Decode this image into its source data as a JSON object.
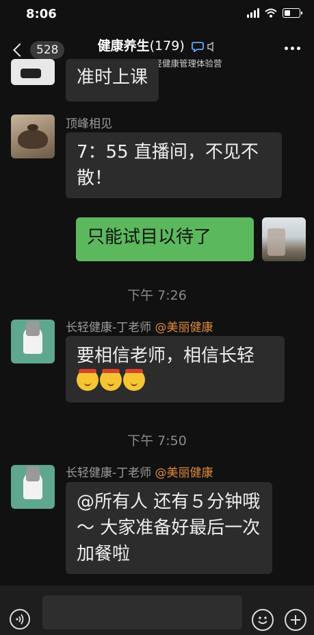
{
  "status_bar": {
    "time": "8:06"
  },
  "navbar": {
    "back_count": "528",
    "title": "健康养生",
    "member_count": "(179)",
    "subtitle": "【丁老师】长轻健康管理体验营"
  },
  "messages": [
    {
      "type": "text",
      "text": "准时上课"
    },
    {
      "type": "text",
      "sender": "顶峰相见",
      "text": "7：55 直播间，不见不散！"
    },
    {
      "type": "text",
      "self": true,
      "text": "只能试目以待了"
    },
    {
      "type": "time",
      "text": "下午 7:26"
    },
    {
      "type": "text",
      "sender": "长轻健康-丁老师",
      "at": "@美丽健康",
      "text": "要相信老师，相信长轻"
    },
    {
      "type": "time",
      "text": "下午 7:50"
    },
    {
      "type": "text",
      "sender": "长轻健康-丁老师",
      "at": "@美丽健康",
      "text": "@所有人  还有５分钟哦～ 大家准备好最后一次加餐啦"
    }
  ],
  "icons": {
    "voice": "voice-icon",
    "emoji": "emoji-icon",
    "plus": "plus-icon",
    "emoji_in_message": "shushing-face-emoji"
  },
  "colors": {
    "background": "#111111",
    "bubble_other": "#2c2c2c",
    "bubble_self": "#5bb85d",
    "mention": "#e08a3c"
  }
}
